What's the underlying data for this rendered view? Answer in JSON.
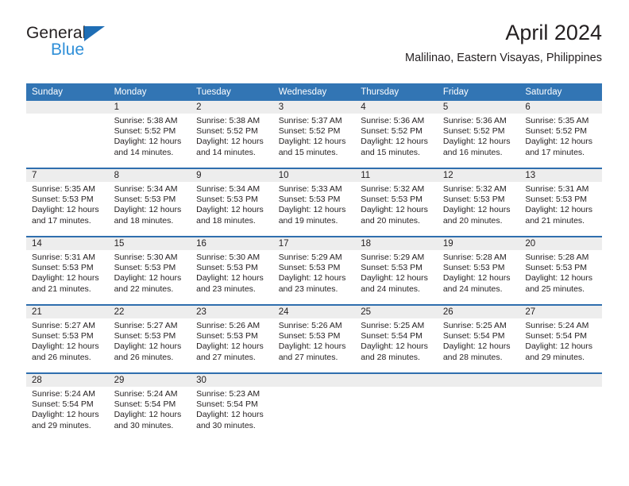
{
  "brand": {
    "name_part1": "General",
    "name_part2": "Blue",
    "triangle_color": "#1f6eb5",
    "blue_text_color": "#2f8fd8"
  },
  "header": {
    "title": "April 2024",
    "subtitle": "Malilinao, Eastern Visayas, Philippines"
  },
  "theme": {
    "header_row_bg": "#3275b4",
    "week_separator": "#2f6fae",
    "daynum_band_bg": "#ededed",
    "text_color": "#231f20"
  },
  "weekdays": [
    "Sunday",
    "Monday",
    "Tuesday",
    "Wednesday",
    "Thursday",
    "Friday",
    "Saturday"
  ],
  "weeks": [
    [
      {
        "day": "",
        "sunrise": "",
        "sunset": "",
        "daylight1": "",
        "daylight2": "",
        "empty": true
      },
      {
        "day": "1",
        "sunrise": "Sunrise: 5:38 AM",
        "sunset": "Sunset: 5:52 PM",
        "daylight1": "Daylight: 12 hours",
        "daylight2": "and 14 minutes."
      },
      {
        "day": "2",
        "sunrise": "Sunrise: 5:38 AM",
        "sunset": "Sunset: 5:52 PM",
        "daylight1": "Daylight: 12 hours",
        "daylight2": "and 14 minutes."
      },
      {
        "day": "3",
        "sunrise": "Sunrise: 5:37 AM",
        "sunset": "Sunset: 5:52 PM",
        "daylight1": "Daylight: 12 hours",
        "daylight2": "and 15 minutes."
      },
      {
        "day": "4",
        "sunrise": "Sunrise: 5:36 AM",
        "sunset": "Sunset: 5:52 PM",
        "daylight1": "Daylight: 12 hours",
        "daylight2": "and 15 minutes."
      },
      {
        "day": "5",
        "sunrise": "Sunrise: 5:36 AM",
        "sunset": "Sunset: 5:52 PM",
        "daylight1": "Daylight: 12 hours",
        "daylight2": "and 16 minutes."
      },
      {
        "day": "6",
        "sunrise": "Sunrise: 5:35 AM",
        "sunset": "Sunset: 5:52 PM",
        "daylight1": "Daylight: 12 hours",
        "daylight2": "and 17 minutes."
      }
    ],
    [
      {
        "day": "7",
        "sunrise": "Sunrise: 5:35 AM",
        "sunset": "Sunset: 5:53 PM",
        "daylight1": "Daylight: 12 hours",
        "daylight2": "and 17 minutes."
      },
      {
        "day": "8",
        "sunrise": "Sunrise: 5:34 AM",
        "sunset": "Sunset: 5:53 PM",
        "daylight1": "Daylight: 12 hours",
        "daylight2": "and 18 minutes."
      },
      {
        "day": "9",
        "sunrise": "Sunrise: 5:34 AM",
        "sunset": "Sunset: 5:53 PM",
        "daylight1": "Daylight: 12 hours",
        "daylight2": "and 18 minutes."
      },
      {
        "day": "10",
        "sunrise": "Sunrise: 5:33 AM",
        "sunset": "Sunset: 5:53 PM",
        "daylight1": "Daylight: 12 hours",
        "daylight2": "and 19 minutes."
      },
      {
        "day": "11",
        "sunrise": "Sunrise: 5:32 AM",
        "sunset": "Sunset: 5:53 PM",
        "daylight1": "Daylight: 12 hours",
        "daylight2": "and 20 minutes."
      },
      {
        "day": "12",
        "sunrise": "Sunrise: 5:32 AM",
        "sunset": "Sunset: 5:53 PM",
        "daylight1": "Daylight: 12 hours",
        "daylight2": "and 20 minutes."
      },
      {
        "day": "13",
        "sunrise": "Sunrise: 5:31 AM",
        "sunset": "Sunset: 5:53 PM",
        "daylight1": "Daylight: 12 hours",
        "daylight2": "and 21 minutes."
      }
    ],
    [
      {
        "day": "14",
        "sunrise": "Sunrise: 5:31 AM",
        "sunset": "Sunset: 5:53 PM",
        "daylight1": "Daylight: 12 hours",
        "daylight2": "and 21 minutes."
      },
      {
        "day": "15",
        "sunrise": "Sunrise: 5:30 AM",
        "sunset": "Sunset: 5:53 PM",
        "daylight1": "Daylight: 12 hours",
        "daylight2": "and 22 minutes."
      },
      {
        "day": "16",
        "sunrise": "Sunrise: 5:30 AM",
        "sunset": "Sunset: 5:53 PM",
        "daylight1": "Daylight: 12 hours",
        "daylight2": "and 23 minutes."
      },
      {
        "day": "17",
        "sunrise": "Sunrise: 5:29 AM",
        "sunset": "Sunset: 5:53 PM",
        "daylight1": "Daylight: 12 hours",
        "daylight2": "and 23 minutes."
      },
      {
        "day": "18",
        "sunrise": "Sunrise: 5:29 AM",
        "sunset": "Sunset: 5:53 PM",
        "daylight1": "Daylight: 12 hours",
        "daylight2": "and 24 minutes."
      },
      {
        "day": "19",
        "sunrise": "Sunrise: 5:28 AM",
        "sunset": "Sunset: 5:53 PM",
        "daylight1": "Daylight: 12 hours",
        "daylight2": "and 24 minutes."
      },
      {
        "day": "20",
        "sunrise": "Sunrise: 5:28 AM",
        "sunset": "Sunset: 5:53 PM",
        "daylight1": "Daylight: 12 hours",
        "daylight2": "and 25 minutes."
      }
    ],
    [
      {
        "day": "21",
        "sunrise": "Sunrise: 5:27 AM",
        "sunset": "Sunset: 5:53 PM",
        "daylight1": "Daylight: 12 hours",
        "daylight2": "and 26 minutes."
      },
      {
        "day": "22",
        "sunrise": "Sunrise: 5:27 AM",
        "sunset": "Sunset: 5:53 PM",
        "daylight1": "Daylight: 12 hours",
        "daylight2": "and 26 minutes."
      },
      {
        "day": "23",
        "sunrise": "Sunrise: 5:26 AM",
        "sunset": "Sunset: 5:53 PM",
        "daylight1": "Daylight: 12 hours",
        "daylight2": "and 27 minutes."
      },
      {
        "day": "24",
        "sunrise": "Sunrise: 5:26 AM",
        "sunset": "Sunset: 5:53 PM",
        "daylight1": "Daylight: 12 hours",
        "daylight2": "and 27 minutes."
      },
      {
        "day": "25",
        "sunrise": "Sunrise: 5:25 AM",
        "sunset": "Sunset: 5:54 PM",
        "daylight1": "Daylight: 12 hours",
        "daylight2": "and 28 minutes."
      },
      {
        "day": "26",
        "sunrise": "Sunrise: 5:25 AM",
        "sunset": "Sunset: 5:54 PM",
        "daylight1": "Daylight: 12 hours",
        "daylight2": "and 28 minutes."
      },
      {
        "day": "27",
        "sunrise": "Sunrise: 5:24 AM",
        "sunset": "Sunset: 5:54 PM",
        "daylight1": "Daylight: 12 hours",
        "daylight2": "and 29 minutes."
      }
    ],
    [
      {
        "day": "28",
        "sunrise": "Sunrise: 5:24 AM",
        "sunset": "Sunset: 5:54 PM",
        "daylight1": "Daylight: 12 hours",
        "daylight2": "and 29 minutes."
      },
      {
        "day": "29",
        "sunrise": "Sunrise: 5:24 AM",
        "sunset": "Sunset: 5:54 PM",
        "daylight1": "Daylight: 12 hours",
        "daylight2": "and 30 minutes."
      },
      {
        "day": "30",
        "sunrise": "Sunrise: 5:23 AM",
        "sunset": "Sunset: 5:54 PM",
        "daylight1": "Daylight: 12 hours",
        "daylight2": "and 30 minutes."
      },
      {
        "day": "",
        "sunrise": "",
        "sunset": "",
        "daylight1": "",
        "daylight2": "",
        "empty": true
      },
      {
        "day": "",
        "sunrise": "",
        "sunset": "",
        "daylight1": "",
        "daylight2": "",
        "empty": true
      },
      {
        "day": "",
        "sunrise": "",
        "sunset": "",
        "daylight1": "",
        "daylight2": "",
        "empty": true
      },
      {
        "day": "",
        "sunrise": "",
        "sunset": "",
        "daylight1": "",
        "daylight2": "",
        "empty": true
      }
    ]
  ]
}
